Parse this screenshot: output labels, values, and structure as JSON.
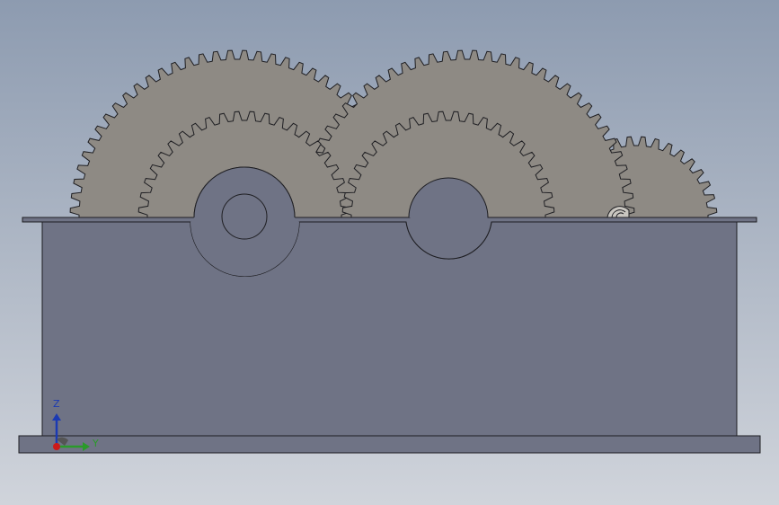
{
  "viewport": {
    "background_top": "#8d9bb0",
    "background_bottom": "#d0d4db"
  },
  "model": {
    "housing_color": "#6f7385",
    "gear_color": "#8e8a84",
    "edge_color": "#1e1e22"
  },
  "triad": {
    "z_label": "Z",
    "y_label": "Y",
    "z_color": "#1b3ab3",
    "y_color": "#2a9a2a",
    "x_color": "#cc1a1a"
  }
}
